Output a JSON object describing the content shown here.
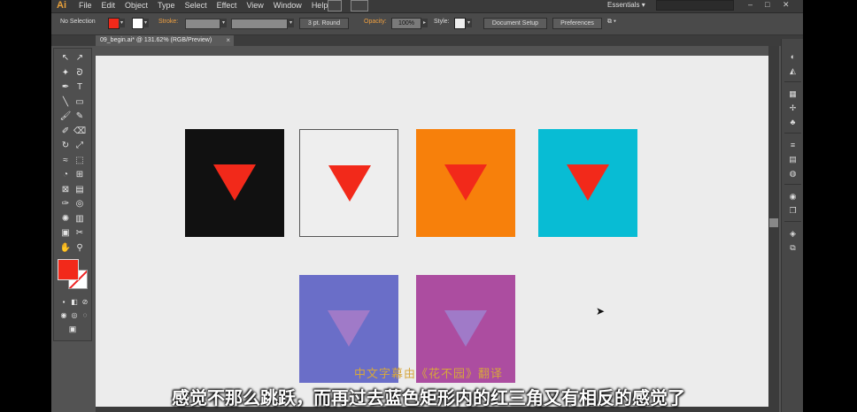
{
  "app": {
    "logo": "Ai",
    "menus": [
      "File",
      "Edit",
      "Object",
      "Type",
      "Select",
      "Effect",
      "View",
      "Window",
      "Help"
    ],
    "workspace": "Essentials",
    "workspace_caret": "▾",
    "window_controls": {
      "minimize": "–",
      "maximize": "□",
      "close": "✕"
    }
  },
  "control_bar": {
    "selection_label": "No Selection",
    "fill_color": "#f2291a",
    "stroke_label": "Stroke:",
    "brush_label": "3 pt. Round",
    "opacity_label": "Opacity:",
    "opacity_value": "100%",
    "style_label": "Style:",
    "document_setup": "Document Setup",
    "preferences": "Preferences"
  },
  "document": {
    "tab_title": "09_begin.ai* @ 131.62% (RGB/Preview)",
    "close": "×"
  },
  "tools": {
    "icons": [
      "selection-icon",
      "direct-selection-icon",
      "magic-wand-icon",
      "lasso-icon",
      "pen-icon",
      "type-icon",
      "line-icon",
      "rectangle-icon",
      "paintbrush-icon",
      "pencil-icon",
      "blob-brush-icon",
      "eraser-icon",
      "rotate-icon",
      "scale-icon",
      "width-icon",
      "free-transform-icon",
      "shape-builder-icon",
      "perspective-icon",
      "mesh-icon",
      "gradient-icon",
      "eyedropper-icon",
      "blend-icon",
      "symbol-sprayer-icon",
      "graph-icon",
      "artboard-icon",
      "slice-icon",
      "hand-icon",
      "zoom-icon"
    ],
    "glyphs": [
      "↖",
      "↗",
      "✦",
      "ᘐ",
      "✒",
      "T",
      "╲",
      "▭",
      "🖌",
      "✎",
      "✐",
      "⌫",
      "↻",
      "⤢",
      "≈",
      "⬚",
      "◔",
      "⊞",
      "⊠",
      "▤",
      "✑",
      "◎",
      "✺",
      "▥",
      "▣",
      "✂",
      "✋",
      "⚲"
    ],
    "fill_color": "#f2291a"
  },
  "artworks": [
    {
      "name": "black-square",
      "bg": "#111111",
      "tri": "#f2291a",
      "border": "none"
    },
    {
      "name": "white-square",
      "bg": "#eeeeee",
      "tri": "#f2291a",
      "border": "1px solid #555"
    },
    {
      "name": "orange-square",
      "bg": "#f7800b",
      "tri": "#f2291a",
      "border": "none"
    },
    {
      "name": "cyan-square",
      "bg": "#08bcd4",
      "tri": "#f2291a",
      "border": "none"
    },
    {
      "name": "blue-square",
      "bg": "#6a6ec8",
      "tri": "#a07ac8",
      "border": "none"
    },
    {
      "name": "purple-square",
      "bg": "#ac4da0",
      "tri": "#a07ac8",
      "border": "none"
    }
  ],
  "subtitles": {
    "credit": "中文字幕由《花不园》翻译",
    "line": "感觉不那么跳跃，而再过去蓝色矩形内的红三角又有相反的感觉了"
  }
}
